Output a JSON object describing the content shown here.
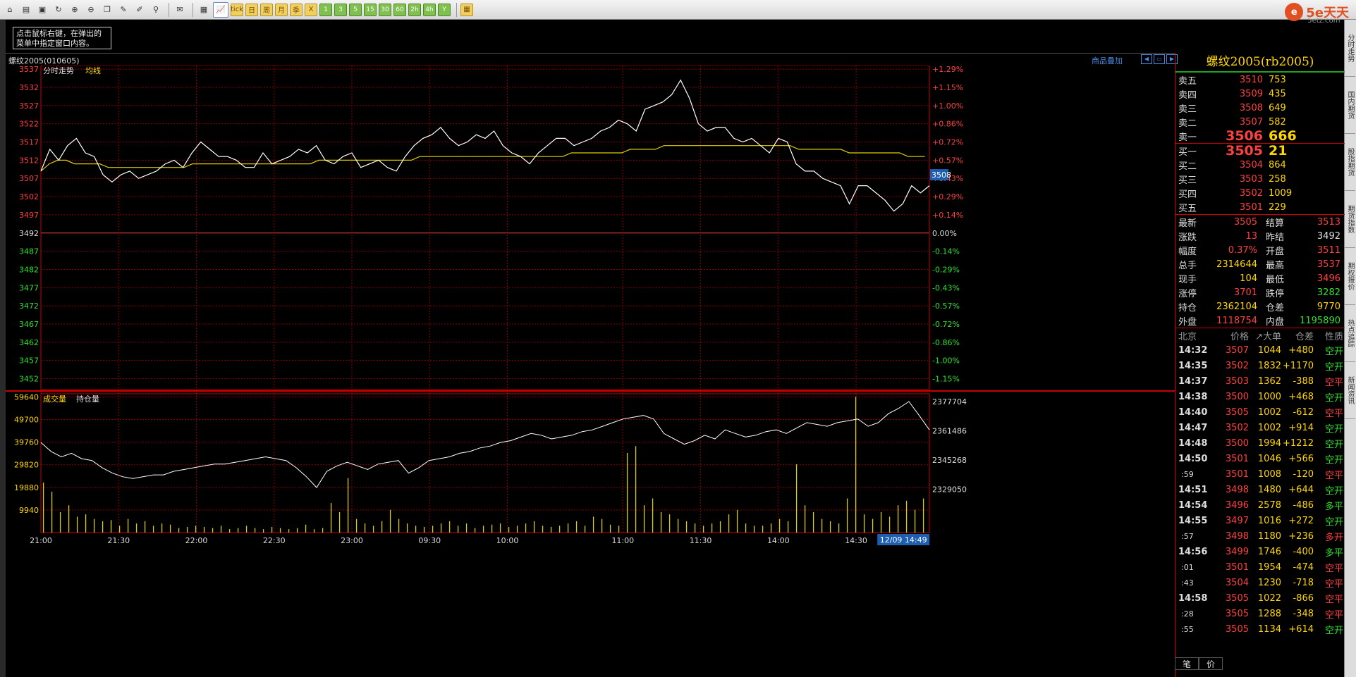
{
  "toolbar": {
    "icons": [
      "home-icon",
      "book-icon",
      "screen-icon",
      "refresh-icon",
      "zoom-in-icon",
      "zoom-out-icon",
      "window-icon",
      "pen-icon",
      "paint-icon",
      "filter-icon",
      "news-icon",
      "table-icon",
      "chart-icon"
    ],
    "periods": [
      "tick",
      "日",
      "周",
      "月",
      "季",
      "X",
      "1",
      "3",
      "5",
      "15",
      "30",
      "60",
      "2h",
      "4h",
      "Y"
    ],
    "calendar_icon": "calendar-icon",
    "brand": "5e天天",
    "brand_sub": "5etz.com"
  },
  "tip": "点击鼠标右键，在弹出的菜单中指定窗口内容。",
  "right_tabs": [
    "分时走势",
    "国内期货",
    "股指期货",
    "期货指数",
    "期权报价",
    "热点追踪",
    "新闻资讯"
  ],
  "chart_header": {
    "title": "螺纹2005(010605)",
    "overlay_label": "商品叠加"
  },
  "chart_data": [
    {
      "type": "line",
      "title": "分时走势",
      "legend": [
        "分时走势",
        "均线"
      ],
      "ylabels_left": [
        "3537",
        "3532",
        "3527",
        "3522",
        "3517",
        "3512",
        "3507",
        "3502",
        "3497",
        "3492",
        "3487",
        "3482",
        "3477",
        "3472",
        "3467",
        "3462",
        "3457",
        "3452"
      ],
      "ylabels_right": [
        "+1.29%",
        "+1.15%",
        "+1.00%",
        "+0.86%",
        "+0.72%",
        "+0.57%",
        "+0.43%",
        "+0.29%",
        "+0.14%",
        "0.00%",
        "-0.14%",
        "-0.29%",
        "-0.43%",
        "-0.57%",
        "-0.72%",
        "-0.86%",
        "-1.00%",
        "-1.15%"
      ],
      "ylim": [
        3449,
        3538
      ],
      "prev_settle": 3492,
      "current_price_tag": "3508",
      "price_series": [
        3509,
        3515,
        3512,
        3516,
        3518,
        3514,
        3513,
        3508,
        3506,
        3508,
        3509,
        3507,
        3508,
        3509,
        3511,
        3512,
        3510,
        3514,
        3517,
        3515,
        3513,
        3513,
        3512,
        3510,
        3510,
        3514,
        3511,
        3512,
        3513,
        3515,
        3514,
        3516,
        3512,
        3511,
        3513,
        3514,
        3510,
        3511,
        3512,
        3510,
        3509,
        3513,
        3516,
        3518,
        3519,
        3521,
        3518,
        3516,
        3517,
        3519,
        3518,
        3520,
        3516,
        3514,
        3513,
        3511,
        3514,
        3516,
        3518,
        3518,
        3516,
        3517,
        3518,
        3520,
        3521,
        3523,
        3522,
        3520,
        3526,
        3527,
        3528,
        3530,
        3534,
        3529,
        3522,
        3520,
        3521,
        3521,
        3518,
        3517,
        3518,
        3516,
        3514,
        3518,
        3517,
        3511,
        3509,
        3509,
        3507,
        3506,
        3505,
        3500,
        3505,
        3505,
        3503,
        3501,
        3498,
        3500,
        3505,
        3503,
        3505
      ],
      "avg_series": [
        3509,
        3511,
        3512,
        3512,
        3511,
        3511,
        3511,
        3511,
        3510,
        3510,
        3510,
        3510,
        3510,
        3510,
        3510,
        3510,
        3510,
        3510,
        3511,
        3511,
        3511,
        3511,
        3511,
        3511,
        3511,
        3511,
        3511,
        3511,
        3511,
        3511,
        3511,
        3511,
        3511,
        3512,
        3512,
        3512,
        3512,
        3512,
        3512,
        3512,
        3512,
        3512,
        3512,
        3512,
        3512,
        3513,
        3513,
        3513,
        3513,
        3513,
        3513,
        3513,
        3513,
        3513,
        3513,
        3513,
        3513,
        3513,
        3513,
        3513,
        3513,
        3513,
        3513,
        3514,
        3514,
        3514,
        3514,
        3514,
        3514,
        3514,
        3515,
        3515,
        3515,
        3515,
        3516,
        3516,
        3516,
        3516,
        3516,
        3516,
        3516,
        3516,
        3516,
        3516,
        3516,
        3516,
        3516,
        3516,
        3516,
        3516,
        3515,
        3515,
        3515,
        3515,
        3515,
        3515,
        3514,
        3514,
        3514,
        3514,
        3514,
        3514,
        3514,
        3513,
        3513,
        3513
      ],
      "xlabels": [
        "21:00",
        "21:30",
        "22:00",
        "22:30",
        "23:00",
        "09:30",
        "10:00",
        "11:00",
        "11:30",
        "14:00",
        "14:30"
      ],
      "time_tag": "12/09 14:49"
    },
    {
      "type": "bar",
      "title": "成交量",
      "legend": [
        "成交量",
        "持仓量"
      ],
      "ylabels_left": [
        "59640",
        "49700",
        "39760",
        "29820",
        "19880",
        "9940"
      ],
      "ylabels_right": [
        "2377704",
        "2361486",
        "2345268",
        "2329050"
      ],
      "ylim": [
        0,
        61000
      ],
      "oi_lim": [
        2305000,
        2382000
      ],
      "volume": [
        22000,
        18000,
        9000,
        12000,
        7000,
        8000,
        6000,
        5000,
        5500,
        3000,
        6000,
        4000,
        5000,
        3000,
        4000,
        3500,
        2000,
        2500,
        3000,
        2500,
        2000,
        3000,
        1500,
        2000,
        3000,
        2000,
        1500,
        2500,
        2000,
        1500,
        2000,
        3500,
        1500,
        2000,
        13000,
        9000,
        24000,
        6000,
        4000,
        3000,
        5000,
        10000,
        6000,
        4000,
        3000,
        2500,
        3000,
        4000,
        5000,
        3000,
        4000,
        2000,
        3000,
        3500,
        4000,
        2500,
        3000,
        4000,
        5000,
        3000,
        2500,
        3000,
        4000,
        5000,
        3000,
        7000,
        6000,
        3500,
        3000,
        35000,
        38000,
        12000,
        15000,
        9000,
        8000,
        6000,
        5000,
        4000,
        3000,
        4000,
        5000,
        8000,
        10000,
        4000,
        3000,
        3000,
        4000,
        6000,
        5000,
        30000,
        12000,
        9000,
        6000,
        5000,
        4000,
        15000,
        59640,
        8000,
        6000,
        9000,
        7000,
        12000,
        14000,
        10000,
        15000
      ],
      "oi_series": [
        2355000,
        2350000,
        2347000,
        2349000,
        2346000,
        2345000,
        2341000,
        2338000,
        2336000,
        2335000,
        2336000,
        2337000,
        2337000,
        2339000,
        2340000,
        2341000,
        2342000,
        2343000,
        2343000,
        2344000,
        2345000,
        2346000,
        2347000,
        2346000,
        2345000,
        2341000,
        2336000,
        2330000,
        2339000,
        2342000,
        2344000,
        2342000,
        2340000,
        2343000,
        2344000,
        2345000,
        2338000,
        2341000,
        2345000,
        2346000,
        2347000,
        2349000,
        2350000,
        2352000,
        2353000,
        2355000,
        2356000,
        2358000,
        2360000,
        2359000,
        2357000,
        2358000,
        2359000,
        2361000,
        2362000,
        2364000,
        2366000,
        2368000,
        2369000,
        2370000,
        2368000,
        2360000,
        2357000,
        2354000,
        2356000,
        2359000,
        2357000,
        2362000,
        2360000,
        2358000,
        2359000,
        2361000,
        2362000,
        2360000,
        2363000,
        2366000,
        2365000,
        2364000,
        2366000,
        2367000,
        2368000,
        2364000,
        2366000,
        2371000,
        2374000,
        2377704,
        2370000,
        2362000
      ]
    }
  ],
  "quote": {
    "title": "螺纹2005(rb2005)",
    "asks": [
      {
        "label": "卖五",
        "price": "3510",
        "vol": "753"
      },
      {
        "label": "卖四",
        "price": "3509",
        "vol": "435"
      },
      {
        "label": "卖三",
        "price": "3508",
        "vol": "649"
      },
      {
        "label": "卖二",
        "price": "3507",
        "vol": "582"
      },
      {
        "label": "卖一",
        "price": "3506",
        "vol": "666"
      }
    ],
    "bids": [
      {
        "label": "买一",
        "price": "3505",
        "vol": "21"
      },
      {
        "label": "买二",
        "price": "3504",
        "vol": "864"
      },
      {
        "label": "买三",
        "price": "3503",
        "vol": "258"
      },
      {
        "label": "买四",
        "price": "3502",
        "vol": "1009"
      },
      {
        "label": "买五",
        "price": "3501",
        "vol": "229"
      }
    ],
    "stats": [
      {
        "k": "最新",
        "v": "3505",
        "c": "#ff4040",
        "k2": "结算",
        "v2": "3513",
        "c2": "#ff4040"
      },
      {
        "k": "涨跌",
        "v": "13",
        "c": "#ff4040",
        "k2": "昨结",
        "v2": "3492",
        "c2": "#dddddd"
      },
      {
        "k": "幅度",
        "v": "0.37%",
        "c": "#ff4040",
        "k2": "开盘",
        "v2": "3511",
        "c2": "#ff4040"
      },
      {
        "k": "总手",
        "v": "2314644",
        "c": "#ffd700",
        "k2": "最高",
        "v2": "3537",
        "c2": "#ff4040"
      },
      {
        "k": "现手",
        "v": "104",
        "c": "#ffd700",
        "k2": "最低",
        "v2": "3496",
        "c2": "#ff4040"
      },
      {
        "k": "涨停",
        "v": "3701",
        "c": "#ff4040",
        "k2": "跌停",
        "v2": "3282",
        "c2": "#30e030"
      },
      {
        "k": "持仓",
        "v": "2362104",
        "c": "#ffd700",
        "k2": "仓差",
        "v2": "9770",
        "c2": "#ffd700"
      },
      {
        "k": "外盘",
        "v": "1118754",
        "c": "#ff4040",
        "k2": "内盘",
        "v2": "1195890",
        "c2": "#30e030"
      }
    ],
    "ticks_header": [
      "北京",
      "价格",
      "↗大单",
      "仓差",
      "性质"
    ],
    "ticks": [
      {
        "t": "14:32",
        "p": "3507",
        "q": "1044",
        "oi": "+480",
        "n": "空开",
        "nc": "#30e030"
      },
      {
        "t": "14:35",
        "p": "3502",
        "q": "1832",
        "oi": "+1170",
        "n": "空开",
        "nc": "#30e030"
      },
      {
        "t": "14:37",
        "p": "3503",
        "q": "1362",
        "oi": "-388",
        "n": "空平",
        "nc": "#ff4040"
      },
      {
        "t": "14:38",
        "p": "3500",
        "q": "1000",
        "oi": "+468",
        "n": "空开",
        "nc": "#30e030"
      },
      {
        "t": "14:40",
        "p": "3505",
        "q": "1002",
        "oi": "-612",
        "n": "空平",
        "nc": "#ff4040"
      },
      {
        "t": "14:47",
        "p": "3502",
        "q": "1002",
        "oi": "+914",
        "n": "空开",
        "nc": "#30e030"
      },
      {
        "t": "14:48",
        "p": "3500",
        "q": "1994",
        "oi": "+1212",
        "n": "空开",
        "nc": "#30e030"
      },
      {
        "t": "14:50",
        "p": "3501",
        "q": "1046",
        "oi": "+566",
        "n": "空开",
        "nc": "#30e030"
      },
      {
        "t": ":59",
        "p": "3501",
        "q": "1008",
        "oi": "-120",
        "n": "空平",
        "nc": "#ff4040"
      },
      {
        "t": "14:51",
        "p": "3498",
        "q": "1480",
        "oi": "+644",
        "n": "空开",
        "nc": "#30e030"
      },
      {
        "t": "14:54",
        "p": "3496",
        "q": "2578",
        "oi": "-486",
        "n": "多平",
        "nc": "#30e030"
      },
      {
        "t": "14:55",
        "p": "3497",
        "q": "1016",
        "oi": "+272",
        "n": "空开",
        "nc": "#30e030"
      },
      {
        "t": ":57",
        "p": "3498",
        "q": "1180",
        "oi": "+236",
        "n": "多开",
        "nc": "#ff4040"
      },
      {
        "t": "14:56",
        "p": "3499",
        "q": "1746",
        "oi": "-400",
        "n": "多平",
        "nc": "#30e030"
      },
      {
        "t": ":01",
        "p": "3501",
        "q": "1954",
        "oi": "-474",
        "n": "空平",
        "nc": "#ff4040"
      },
      {
        "t": ":43",
        "p": "3504",
        "q": "1230",
        "oi": "-718",
        "n": "空平",
        "nc": "#ff4040"
      },
      {
        "t": "14:58",
        "p": "3505",
        "q": "1022",
        "oi": "-866",
        "n": "空平",
        "nc": "#ff4040"
      },
      {
        "t": ":28",
        "p": "3505",
        "q": "1288",
        "oi": "-348",
        "n": "空平",
        "nc": "#ff4040"
      },
      {
        "t": ":55",
        "p": "3505",
        "q": "1134",
        "oi": "+614",
        "n": "空开",
        "nc": "#30e030"
      }
    ],
    "bottom_tabs": [
      "笔",
      "价"
    ]
  }
}
